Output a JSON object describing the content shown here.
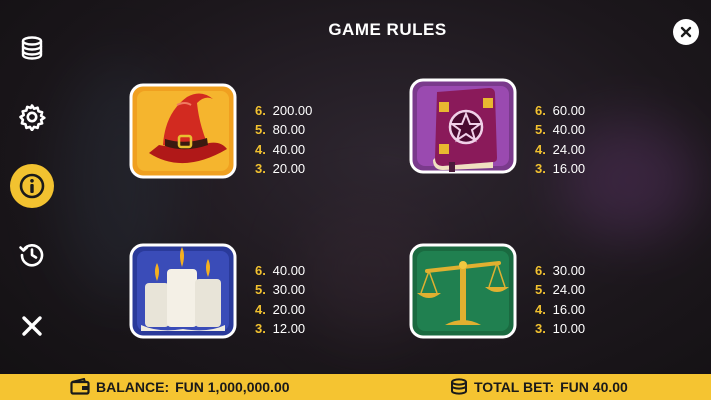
{
  "title": "GAME RULES",
  "sidebar": {
    "items": [
      {
        "icon": "coin-stack-icon",
        "active": false
      },
      {
        "icon": "gear-icon",
        "active": false
      },
      {
        "icon": "info-icon",
        "active": true
      },
      {
        "icon": "history-icon",
        "active": false
      },
      {
        "icon": "close-icon",
        "active": false
      }
    ]
  },
  "colors": {
    "accent": "#f2c230",
    "bar": "#f5c431"
  },
  "symbols": [
    {
      "icon": "witch-hat-icon",
      "pays": [
        {
          "count": "6.",
          "value": "200.00"
        },
        {
          "count": "5.",
          "value": "80.00"
        },
        {
          "count": "4.",
          "value": "40.00"
        },
        {
          "count": "3.",
          "value": "20.00"
        }
      ]
    },
    {
      "icon": "spell-book-icon",
      "pays": [
        {
          "count": "6.",
          "value": "60.00"
        },
        {
          "count": "5.",
          "value": "40.00"
        },
        {
          "count": "4.",
          "value": "24.00"
        },
        {
          "count": "3.",
          "value": "16.00"
        }
      ]
    },
    {
      "icon": "candles-icon",
      "pays": [
        {
          "count": "6.",
          "value": "40.00"
        },
        {
          "count": "5.",
          "value": "30.00"
        },
        {
          "count": "4.",
          "value": "20.00"
        },
        {
          "count": "3.",
          "value": "12.00"
        }
      ]
    },
    {
      "icon": "scales-icon",
      "pays": [
        {
          "count": "6.",
          "value": "30.00"
        },
        {
          "count": "5.",
          "value": "24.00"
        },
        {
          "count": "4.",
          "value": "16.00"
        },
        {
          "count": "3.",
          "value": "10.00"
        }
      ]
    }
  ],
  "footer": {
    "balance_label": "BALANCE:",
    "balance_value": "FUN 1,000,000.00",
    "bet_label": "TOTAL BET:",
    "bet_value": "FUN 40.00"
  }
}
